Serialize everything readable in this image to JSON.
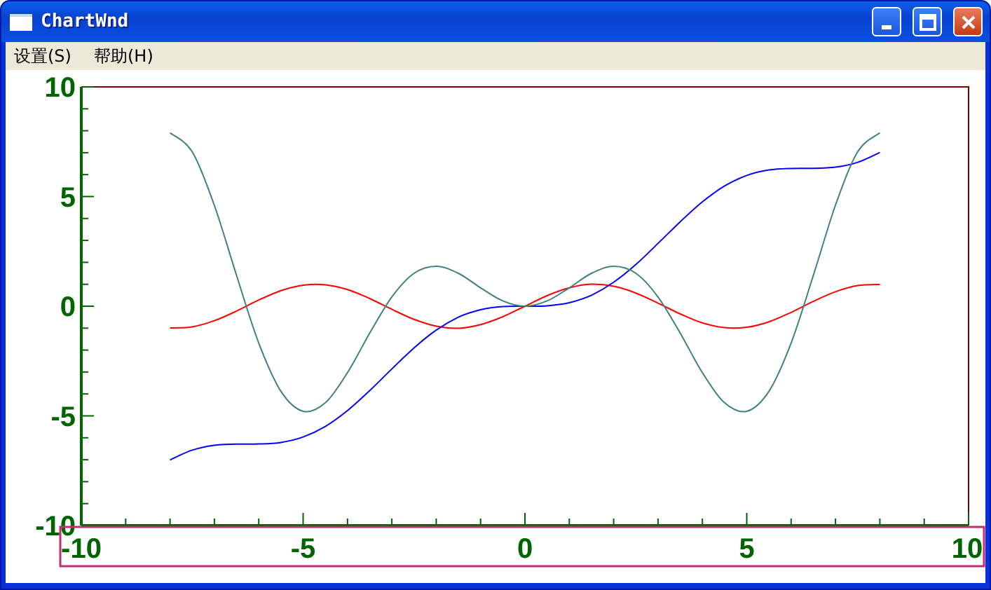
{
  "window": {
    "title": "ChartWnd"
  },
  "menu": [
    {
      "label": "设置(S)"
    },
    {
      "label": "帮助(H)"
    }
  ],
  "chart": {
    "chart_data": {
      "type": "line",
      "x": [
        -8,
        -7.5,
        -7,
        -6.5,
        -6,
        -5.5,
        -5,
        -4.5,
        -4,
        -3.5,
        -3,
        -2.5,
        -2,
        -1.5,
        -1,
        -0.5,
        0,
        0.5,
        1,
        1.5,
        2,
        2.5,
        3,
        3.5,
        4,
        4.5,
        5,
        5.5,
        6,
        6.5,
        7,
        7.5,
        8
      ],
      "series": [
        {
          "color": "#ff0000",
          "values": [
            -0.99,
            -0.94,
            -0.66,
            -0.22,
            0.28,
            0.71,
            0.96,
            0.98,
            0.76,
            0.35,
            -0.14,
            -0.6,
            -0.91,
            -1,
            -0.84,
            -0.48,
            0,
            0.48,
            0.84,
            1,
            0.91,
            0.6,
            0.14,
            -0.35,
            -0.76,
            -0.98,
            -0.96,
            -0.71,
            -0.28,
            0.22,
            0.66,
            0.94,
            0.99
          ]
        },
        {
          "color": "#0000ff",
          "values": [
            -7.01,
            -6.56,
            -6.34,
            -6.29,
            -6.28,
            -6.21,
            -5.96,
            -5.48,
            -4.76,
            -3.85,
            -2.86,
            -1.9,
            -1.09,
            -0.5,
            -0.16,
            -0.02,
            0,
            0.02,
            0.16,
            0.5,
            1.09,
            1.9,
            2.86,
            3.85,
            4.76,
            5.48,
            5.96,
            6.21,
            6.28,
            6.29,
            6.34,
            6.56,
            7.01
          ]
        },
        {
          "color": "#408080",
          "values": [
            7.91,
            7.04,
            4.6,
            1.4,
            -1.68,
            -3.88,
            -4.79,
            -4.4,
            -3.03,
            -1.23,
            0.42,
            1.5,
            1.82,
            1.5,
            0.84,
            0.24,
            0,
            0.24,
            0.84,
            1.5,
            1.82,
            1.5,
            0.42,
            -1.23,
            -3.03,
            -4.4,
            -4.79,
            -3.88,
            -1.68,
            1.4,
            4.6,
            7.04,
            7.91
          ]
        }
      ],
      "xlim": [
        -10,
        10
      ],
      "ylim": [
        -10,
        10
      ],
      "xticks": [
        -10,
        -5,
        0,
        5,
        10
      ],
      "yticks": [
        -10,
        -5,
        0,
        5,
        10
      ]
    }
  }
}
